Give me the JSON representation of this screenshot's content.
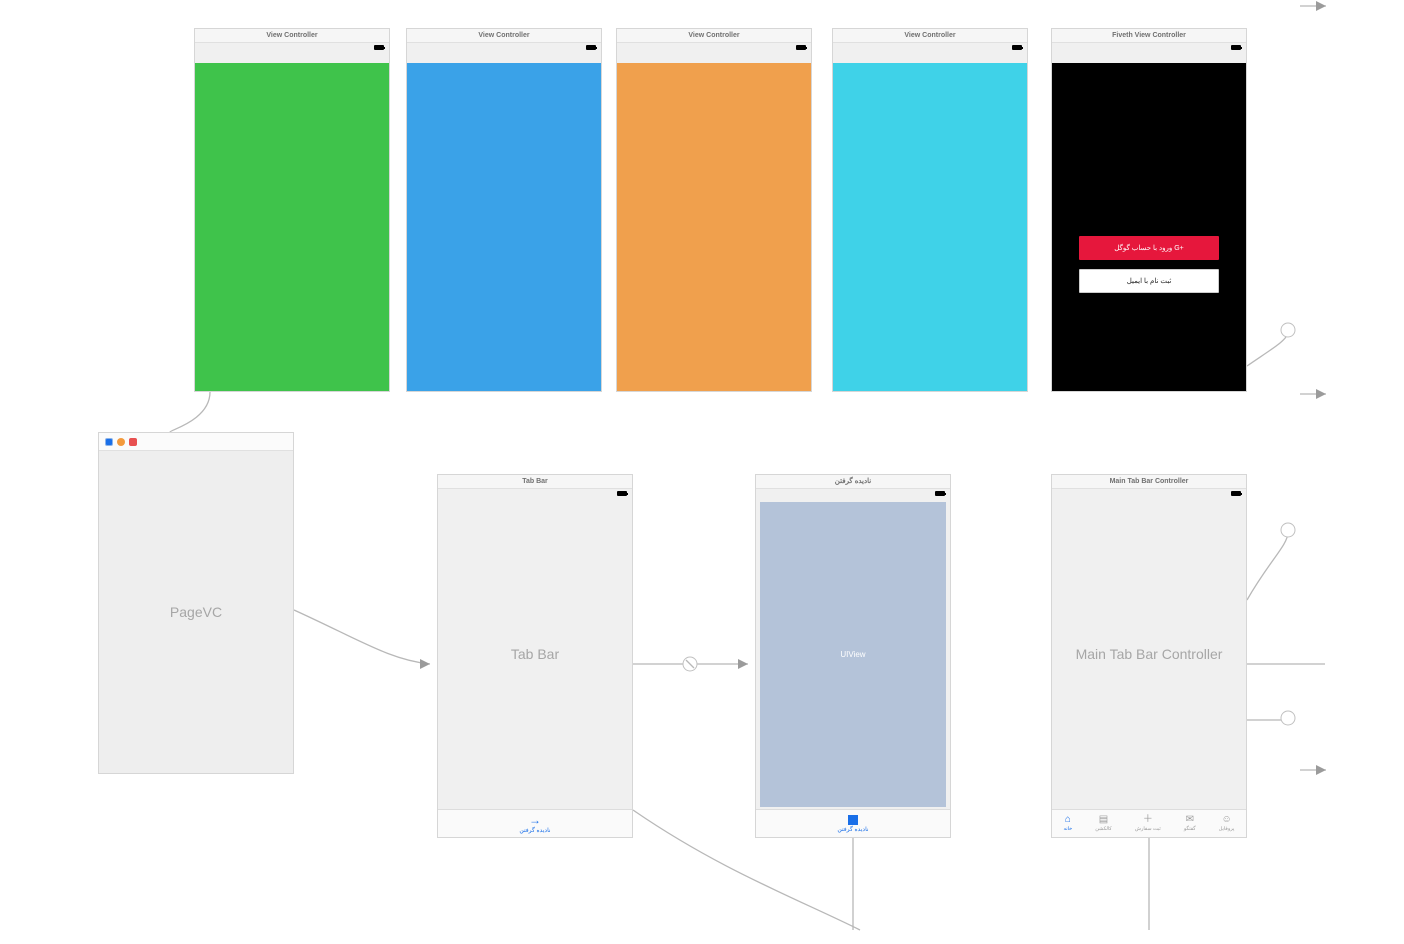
{
  "top_vcs": [
    {
      "title": "View Controller"
    },
    {
      "title": "View Controller"
    },
    {
      "title": "View Controller"
    },
    {
      "title": "View Controller"
    },
    {
      "title": "Fiveth View Controller",
      "google_btn": "ورود با حساب گوگل  G+",
      "email_btn": "ثبت نام با ایمیل"
    }
  ],
  "pagevc": {
    "body": "PageVC"
  },
  "tabbar": {
    "title": "Tab Bar",
    "body": "Tab Bar",
    "tab_label": "نادیده گرفتن"
  },
  "ignore_vc": {
    "title": "نادیده گرفتن",
    "uiview": "UIView",
    "tab_label": "نادیده گرفتن"
  },
  "maintab": {
    "title": "Main Tab Bar Controller",
    "body": "Main Tab Bar Controller",
    "tabs": [
      {
        "label": "خانه"
      },
      {
        "label": "کالکشن"
      },
      {
        "label": "ثبت سفارش"
      },
      {
        "label": "گفتگو"
      },
      {
        "label": "پروفایل"
      }
    ]
  }
}
